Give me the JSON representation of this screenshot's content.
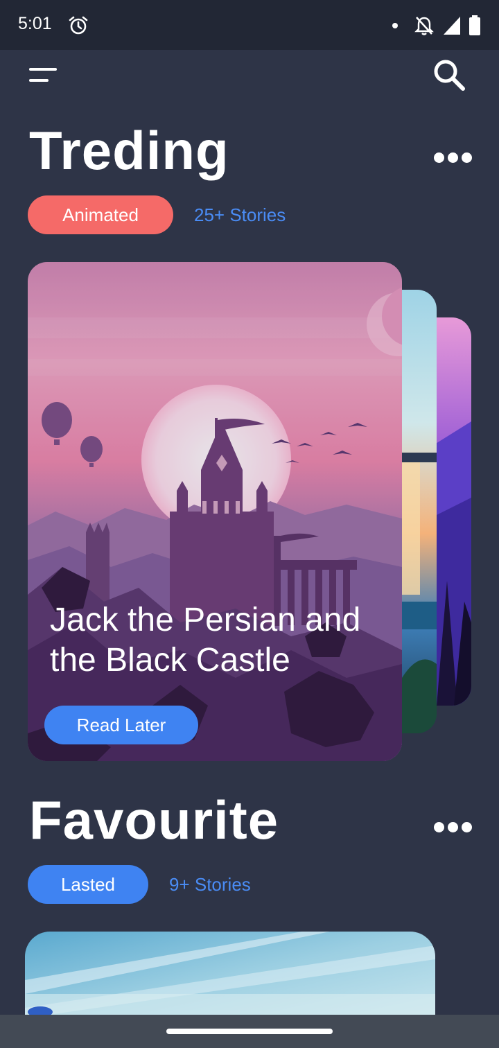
{
  "status_bar": {
    "time": "5:01",
    "icons": [
      "alarm-icon",
      "notification-dot-icon",
      "notifications-off-icon",
      "signal-icon",
      "battery-icon"
    ]
  },
  "header": {
    "menu_icon": "menu-icon",
    "search_icon": "search-icon"
  },
  "trending": {
    "title": "Treding",
    "filter_label": "Animated",
    "count_label": "25+ Stories",
    "featured": {
      "title": "Jack the Persian and the Black Castle",
      "action_label": "Read Later"
    }
  },
  "favourite": {
    "title": "Favourite",
    "filter_label": "Lasted",
    "count_label": "9+ Stories"
  },
  "colors": {
    "background": "#2e3447",
    "status_bar": "#222735",
    "coral_pill": "#f56a68",
    "blue_pill": "#3f83f2",
    "link_blue": "#4a8cf5",
    "nav_bar": "#434a55"
  }
}
